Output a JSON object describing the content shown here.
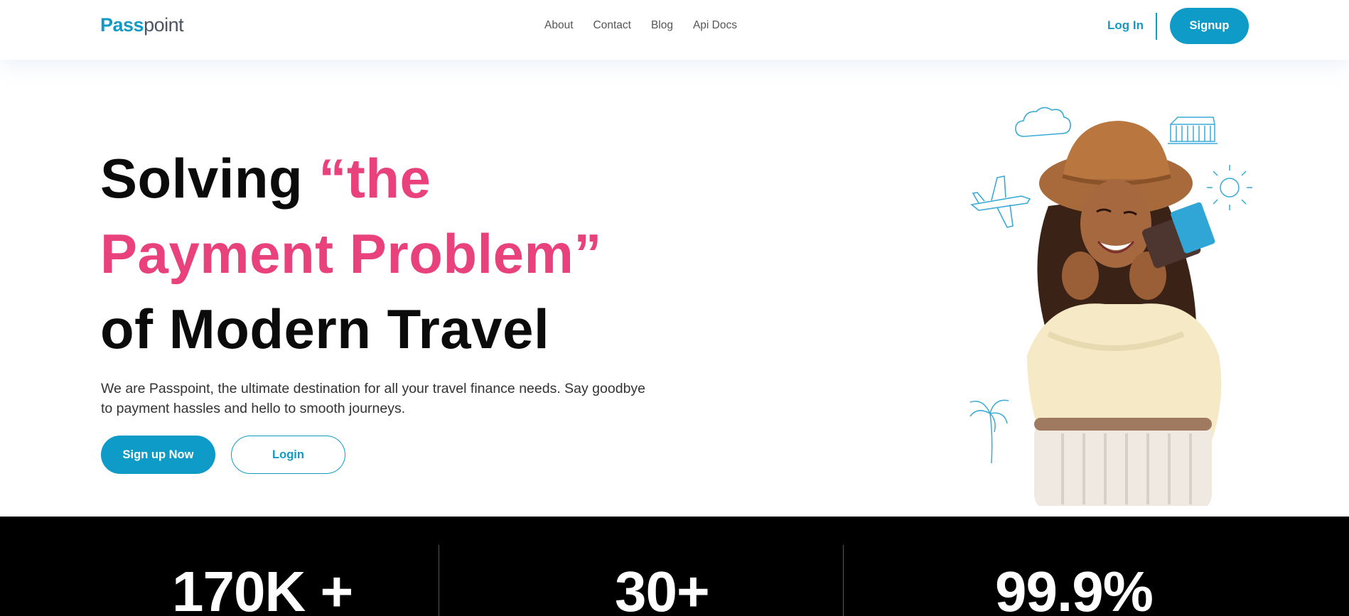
{
  "brand": {
    "logo_a": "Pass",
    "logo_b": "point"
  },
  "nav": {
    "links": [
      "About",
      "Contact",
      "Blog",
      "Api Docs"
    ],
    "login": "Log In",
    "signup": "Signup"
  },
  "hero": {
    "title_line1_a": "Solving ",
    "title_line1_b": "“the",
    "title_line2": "Payment Problem”",
    "title_line3": "of Modern Travel",
    "subtitle": "We are Passpoint, the ultimate destination for all your travel finance needs. Say goodbye to payment hassles and hello to smooth journeys.",
    "cta_primary": "Sign up Now",
    "cta_secondary": "Login"
  },
  "stats": [
    "170K +",
    "30+",
    "99.9%"
  ],
  "colors": {
    "brand": "#0f9bc8",
    "accent": "#e8417c",
    "dark": "#000000"
  },
  "icons": [
    "cloud-icon",
    "airplane-icon",
    "sun-icon",
    "building-icon",
    "palm-tree-icon",
    "credit-card-icon"
  ]
}
